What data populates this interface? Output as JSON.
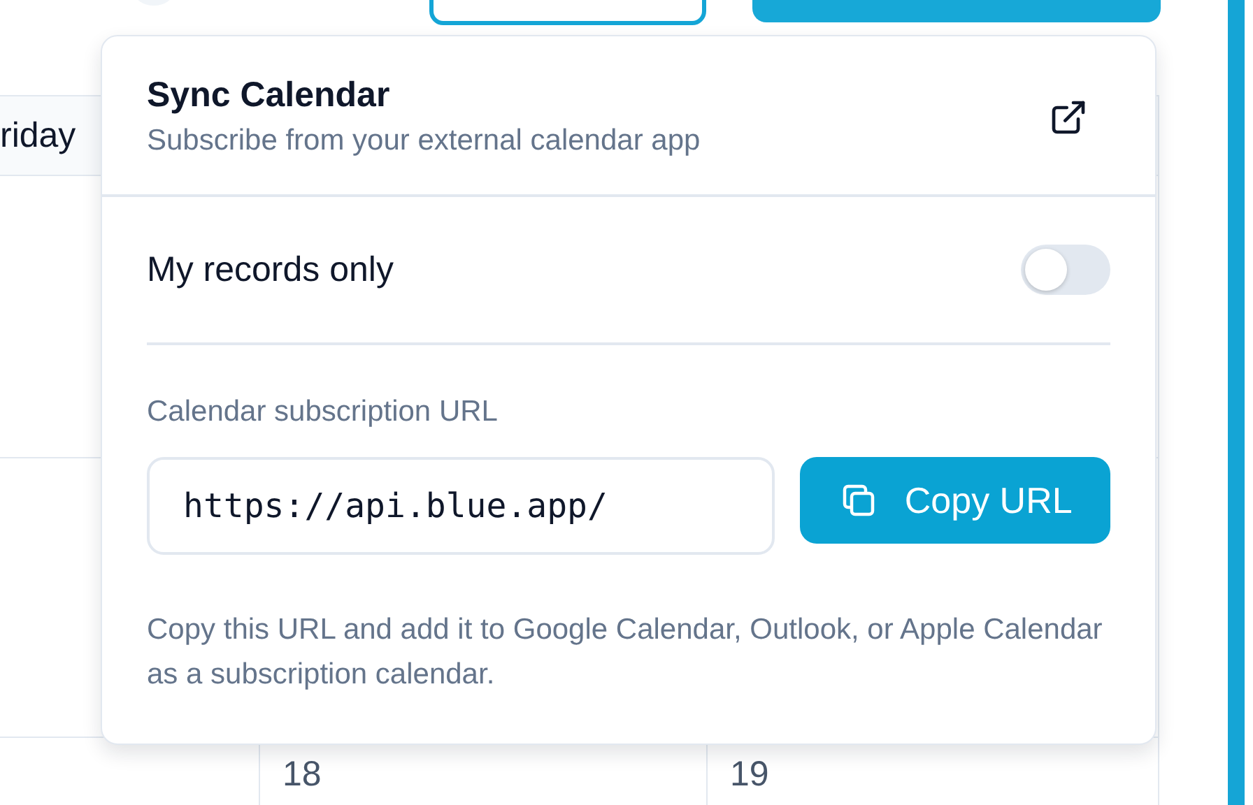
{
  "calendar": {
    "header": "riday",
    "dates": [
      "18",
      "19"
    ]
  },
  "popover": {
    "title": "Sync Calendar",
    "subtitle": "Subscribe from your external calendar app",
    "toggle": {
      "label": "My records only",
      "on": false
    },
    "url_label": "Calendar subscription URL",
    "url_value": "https://api.blue.app/",
    "copy_button": "Copy URL",
    "help": "Copy this URL and add it to Google Calendar, Outlook, or Apple Calendar as a subscription calendar."
  }
}
